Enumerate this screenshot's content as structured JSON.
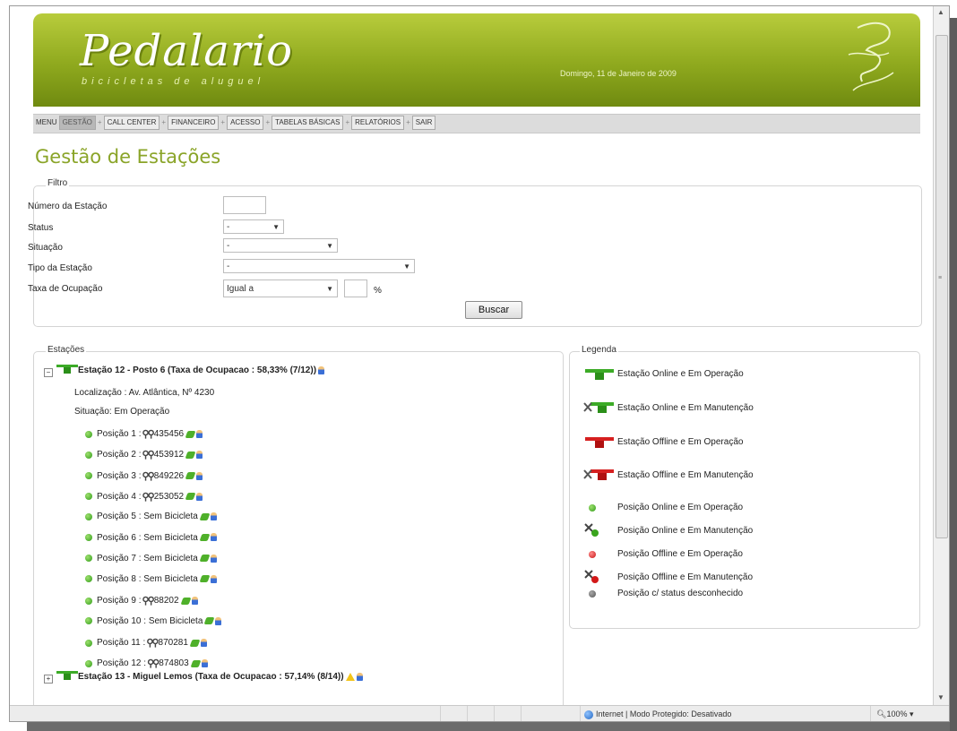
{
  "header": {
    "logo_text": "Pedalario",
    "tagline": "bicicletas de aluguel",
    "date": "Domingo, 11 de Janeiro de 2009"
  },
  "menu": {
    "label": "MENU",
    "items": [
      "GESTÃO",
      "CALL CENTER",
      "FINANCEIRO",
      "ACESSO",
      "TABELAS BÁSICAS",
      "RELATÓRIOS",
      "SAIR"
    ],
    "active": "GESTÃO"
  },
  "page_title": "Gestão de Estações",
  "filter": {
    "legend": "Filtro",
    "numero_label": "Número da Estação",
    "numero_value": "",
    "status_label": "Status",
    "status_value": "-",
    "situacao_label": "Situação",
    "situacao_value": "-",
    "tipo_label": "Tipo da Estação",
    "tipo_value": "-",
    "taxa_label": "Taxa de Ocupação",
    "taxa_op_value": "Igual a",
    "taxa_value": "",
    "percent": "%",
    "buscar_label": "Buscar"
  },
  "stations": {
    "legend": "Estações",
    "station12": {
      "title": "Estação 12 - Posto 6 (Taxa de Ocupacao : 58,33% (7/12))",
      "location": "Localização : Av. Atlântica, Nº 4230",
      "situation": "Situação: Em Operação",
      "positions": [
        {
          "label": "Posição 1 :",
          "bike": "435456",
          "has_bike": true
        },
        {
          "label": "Posição 2 :",
          "bike": "453912",
          "has_bike": true
        },
        {
          "label": "Posição 3 :",
          "bike": "849226",
          "has_bike": true
        },
        {
          "label": "Posição 4 :",
          "bike": "253052",
          "has_bike": true
        },
        {
          "label": "Posição 5 : Sem Bicicleta",
          "bike": "",
          "has_bike": false
        },
        {
          "label": "Posição 6 : Sem Bicicleta",
          "bike": "",
          "has_bike": false
        },
        {
          "label": "Posição 7 : Sem Bicicleta",
          "bike": "",
          "has_bike": false
        },
        {
          "label": "Posição 8 : Sem Bicicleta",
          "bike": "",
          "has_bike": false
        },
        {
          "label": "Posição 9 :",
          "bike": "88202",
          "has_bike": true
        },
        {
          "label": "Posição 10 : Sem Bicicleta",
          "bike": "",
          "has_bike": false
        },
        {
          "label": "Posição 11 :",
          "bike": "870281",
          "has_bike": true
        },
        {
          "label": "Posição 12 :",
          "bike": "874803",
          "has_bike": true
        }
      ]
    },
    "station13": {
      "title": "Estação 13 - Miguel Lemos (Taxa de Ocupacao : 57,14% (8/14))"
    }
  },
  "legend_box": {
    "legend": "Legenda",
    "items": [
      "Estação Online e Em Operação",
      "Estação Online e Em Manutenção",
      "Estação Offline e Em Operação",
      "Estação Offline e Em Manutenção",
      "Posição Online e Em Operação",
      "Posição Online e Em Manutenção",
      "Posição Offline e Em Operação",
      "Posição Offline e Em Manutenção",
      "Posição c/ status desconhecido"
    ]
  },
  "statusbar": {
    "zone": "Internet | Modo Protegido: Desativado",
    "zoom": "100%"
  },
  "colors": {
    "brand_green": "#8fa91e",
    "title_green": "#8aa428"
  }
}
